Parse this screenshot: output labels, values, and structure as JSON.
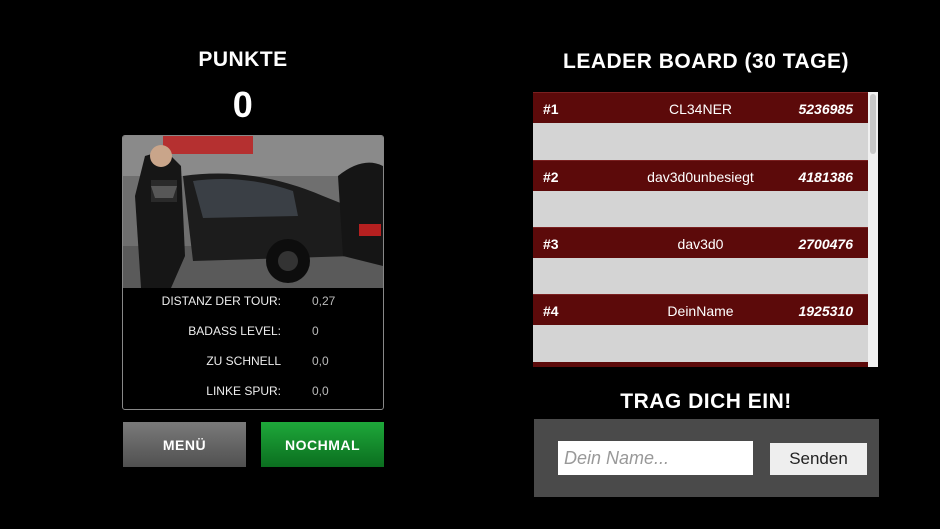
{
  "score": {
    "title": "PUNKTE",
    "value": "0"
  },
  "stats": [
    {
      "label": "DISTANZ DER TOUR:",
      "value": "0,27"
    },
    {
      "label": "BADASS LEVEL:",
      "value": "0"
    },
    {
      "label": "ZU SCHNELL",
      "value": "0,0"
    },
    {
      "label": "LINKE SPUR:",
      "value": "0,0"
    }
  ],
  "buttons": {
    "menu_label": "MENÜ",
    "again_label": "NOCHMAL"
  },
  "leaderboard": {
    "title": "LEADER BOARD (30 TAGE)",
    "entries": [
      {
        "rank": "#1",
        "name": "CL34NER",
        "score": "5236985"
      },
      {
        "rank": "#2",
        "name": "dav3d0unbesiegt",
        "score": "4181386"
      },
      {
        "rank": "#3",
        "name": "dav3d0",
        "score": "2700476"
      },
      {
        "rank": "#4",
        "name": "DeinName",
        "score": "1925310"
      }
    ]
  },
  "entry_form": {
    "title": "TRAG DICH EIN!",
    "name_placeholder": "Dein Name...",
    "name_value": "",
    "submit_label": "Senden"
  },
  "colors": {
    "leaderboard_header": "#5c0a0a",
    "again_button": "#1a9c35",
    "menu_button": "#666666"
  }
}
